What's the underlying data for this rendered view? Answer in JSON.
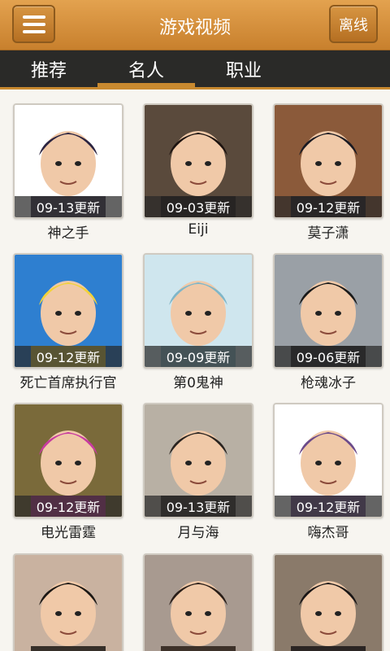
{
  "header": {
    "title": "游戏视频",
    "offline_label": "离线",
    "menu_icon": "menu-icon"
  },
  "tabs": [
    {
      "label": "推荐"
    },
    {
      "label": "名人",
      "active": true
    },
    {
      "label": "职业"
    }
  ],
  "cards": [
    {
      "date": "09-13更新",
      "name": "神之手",
      "bg": "#ffffff",
      "accent": "#2b2340"
    },
    {
      "date": "09-03更新",
      "name": "Eiji",
      "bg": "#5a4a3c",
      "accent": "#1e1410"
    },
    {
      "date": "09-12更新",
      "name": "莫子潇",
      "bg": "#8b5a3a",
      "accent": "#1a1a22"
    },
    {
      "date": "09-12更新",
      "name": "死亡首席执行官",
      "bg": "#2e7fd0",
      "accent": "#f2d23a"
    },
    {
      "date": "09-09更新",
      "name": "第0鬼神",
      "bg": "#cfe6ee",
      "accent": "#7fb6c8"
    },
    {
      "date": "09-06更新",
      "name": "枪魂冰子",
      "bg": "#9aa0a6",
      "accent": "#1a1a1a"
    },
    {
      "date": "09-12更新",
      "name": "电光雷霆",
      "bg": "#7a6a3a",
      "accent": "#c83aa0"
    },
    {
      "date": "09-13更新",
      "name": "月与海",
      "bg": "#b8b0a4",
      "accent": "#2a2420"
    },
    {
      "date": "09-12更新",
      "name": "嗨杰哥",
      "bg": "#ffffff",
      "accent": "#6b4a8a"
    },
    {
      "date": "",
      "name": "",
      "bg": "#c9b2a0",
      "accent": "#1c1814"
    },
    {
      "date": "",
      "name": "",
      "bg": "#a89a90",
      "accent": "#2a1e18"
    },
    {
      "date": "",
      "name": "",
      "bg": "#8a7a6a",
      "accent": "#1a1616"
    }
  ]
}
